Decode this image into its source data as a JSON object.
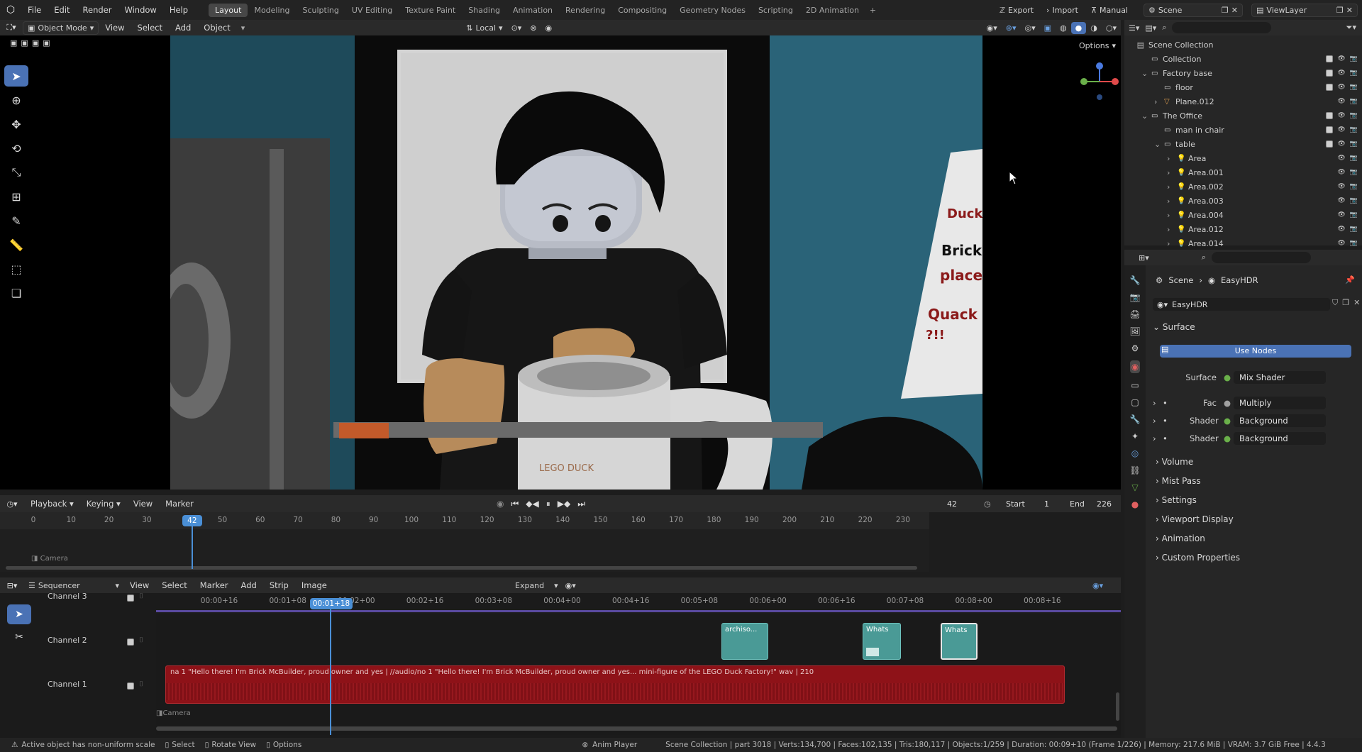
{
  "menu": {
    "items": [
      "File",
      "Edit",
      "Render",
      "Window",
      "Help"
    ],
    "workspaces": [
      "Layout",
      "Modeling",
      "Sculpting",
      "UV Editing",
      "Texture Paint",
      "Shading",
      "Animation",
      "Rendering",
      "Compositing",
      "Geometry Nodes",
      "Scripting",
      "2D Animation"
    ],
    "active_workspace": "Layout",
    "export_label": "Export",
    "import_label": "Import",
    "manual_label": "Manual",
    "scene_label": "Scene",
    "viewlayer_label": "ViewLayer"
  },
  "viewport_header": {
    "mode": "Object Mode",
    "menus": [
      "View",
      "Select",
      "Add",
      "Object"
    ],
    "orientation": "Local",
    "options_label": "Options"
  },
  "viewport_scene": {
    "sign_lines": [
      "Duck",
      "Brick",
      "place",
      "Quack",
      "?!!"
    ],
    "mug_text": "LEGO DUCK"
  },
  "timeline": {
    "menus": [
      "Playback",
      "Keying",
      "View",
      "Marker"
    ],
    "current_frame": "42",
    "start_label": "Start",
    "start_value": "1",
    "end_label": "End",
    "end_value": "226",
    "ruler": [
      "0",
      "10",
      "20",
      "30",
      "50",
      "60",
      "70",
      "80",
      "90",
      "100",
      "110",
      "120",
      "130",
      "140",
      "150",
      "160",
      "170",
      "180",
      "190",
      "200",
      "210",
      "220",
      "230"
    ],
    "playhead": "42",
    "track_label": "Camera"
  },
  "sequencer": {
    "editor": "Sequencer",
    "menus": [
      "View",
      "Select",
      "Marker",
      "Add",
      "Strip",
      "Image"
    ],
    "expand_label": "Expand",
    "ruler": [
      "00:00+16",
      "00:01+08",
      "00:02+00",
      "00:02+16",
      "00:03+08",
      "00:04+00",
      "00:04+16",
      "00:05+08",
      "00:06+00",
      "00:06+16",
      "00:07+08",
      "00:08+00",
      "00:08+16"
    ],
    "playhead": "00:01+18",
    "channels": [
      "Channel 3",
      "Channel 2",
      "Channel 1"
    ],
    "strips_ch2": [
      "archiso...",
      "Whats",
      "Whats"
    ],
    "text_strip": "na 1 \"Hello there! I'm Brick McBuilder, proud owner and yes | //audio/no 1 \"Hello there! I'm Brick McBuilder, proud owner and yes... mini-figure of the LEGO Duck Factory!\" wav | 210",
    "camera_label": "Camera"
  },
  "outliner": {
    "root": "Scene Collection",
    "rows": [
      {
        "label": "Collection",
        "indent": 1,
        "expand": "",
        "check": true
      },
      {
        "label": "Factory base",
        "indent": 1,
        "expand": "v",
        "check": true
      },
      {
        "label": "floor",
        "indent": 2,
        "expand": "",
        "check": true
      },
      {
        "label": "Plane.012",
        "indent": 2,
        "expand": ">",
        "check": false
      },
      {
        "label": "The Office",
        "indent": 1,
        "expand": "v",
        "check": true
      },
      {
        "label": "man in chair",
        "indent": 2,
        "expand": "",
        "check": true
      },
      {
        "label": "table",
        "indent": 2,
        "expand": "v",
        "check": true
      },
      {
        "label": "Area",
        "indent": 3,
        "expand": ">",
        "check": false
      },
      {
        "label": "Area.001",
        "indent": 3,
        "expand": ">",
        "check": false
      },
      {
        "label": "Area.002",
        "indent": 3,
        "expand": ">",
        "check": false
      },
      {
        "label": "Area.003",
        "indent": 3,
        "expand": ">",
        "check": false
      },
      {
        "label": "Area.004",
        "indent": 3,
        "expand": ">",
        "check": false
      },
      {
        "label": "Area.012",
        "indent": 3,
        "expand": ">",
        "check": false
      },
      {
        "label": "Area.014",
        "indent": 3,
        "expand": ">",
        "check": false
      }
    ]
  },
  "properties": {
    "breadcrumb_scene": "Scene",
    "breadcrumb_world": "EasyHDR",
    "world_name": "EasyHDR",
    "surface_panel": "Surface",
    "use_nodes": "Use Nodes",
    "surface_label": "Surface",
    "surface_value": "Mix Shader",
    "fac_label": "Fac",
    "fac_value": "Multiply",
    "shader1_label": "Shader",
    "shader1_value": "Background",
    "shader2_label": "Shader",
    "shader2_value": "Background",
    "panels": [
      "Volume",
      "Mist Pass",
      "Settings",
      "Viewport Display",
      "Animation",
      "Custom Properties"
    ]
  },
  "status": {
    "warning": "Active object has non-uniform scale",
    "select": "Select",
    "rotate": "Rotate View",
    "options": "Options",
    "anim_player": "Anim Player",
    "stats": "Scene Collection | part 3018 | Verts:134,700 | Faces:102,135 | Tris:180,117 | Objects:1/259 | Duration: 00:09+10 (Frame 1/226) | Memory: 217.6 MiB | VRAM: 3.7 GiB Free | 4.4.3"
  },
  "colors": {
    "accent": "#4a72b5",
    "strip_teal": "#4a9a96",
    "strip_red": "#8e1218",
    "playhead": "#4a8fd6"
  }
}
